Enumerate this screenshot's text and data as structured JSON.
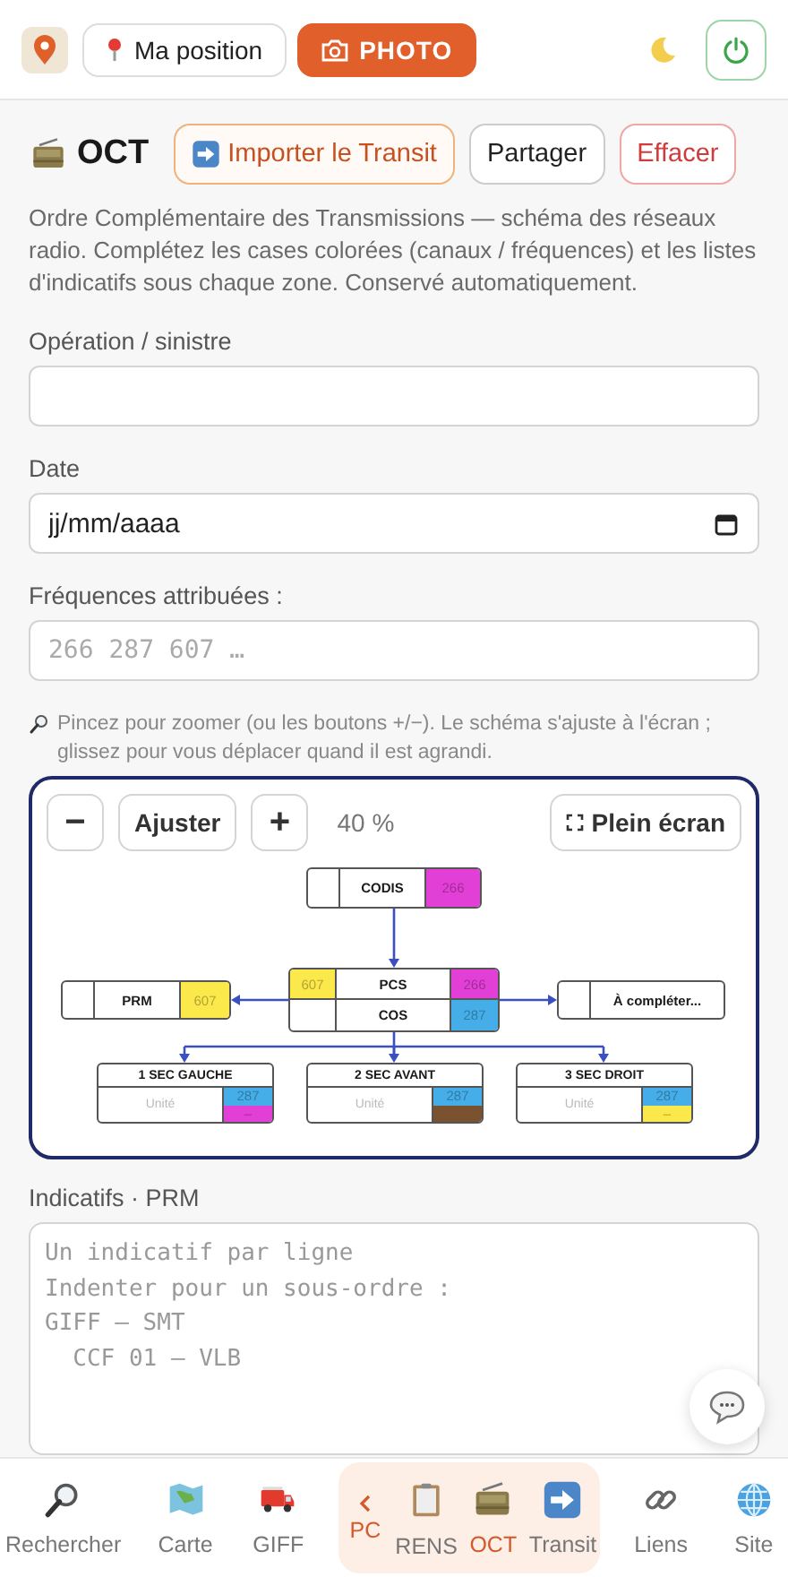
{
  "header": {
    "position_button": "Ma position",
    "photo_button": "PHOTO"
  },
  "title": {
    "text": "OCT",
    "actions": [
      {
        "kind": "primary",
        "label": "Importer le Transit"
      },
      {
        "kind": "neutral",
        "label": "Partager"
      },
      {
        "kind": "danger",
        "label": "Effacer"
      }
    ]
  },
  "description": "Ordre Complémentaire des Transmissions — schéma des réseaux radio. Complétez les cases colorées (canaux / fréquences) et les listes d'indicatifs sous chaque zone. Conservé automatiquement.",
  "fields": [
    {
      "label": "Opération / sinistre",
      "kind": "text"
    },
    {
      "label": "Date",
      "kind": "date",
      "placeholder": "jj/mm/aaaa"
    },
    {
      "label": "Fréquences attribuées :",
      "kind": "mono",
      "placeholder": "266 287 607 …"
    }
  ],
  "hint": "Pincez pour zoomer (ou les boutons +/−). Le schéma s'ajuste à l'écran ; glissez pour vous déplacer quand il est agrandi.",
  "diagram": {
    "zoom_out": "−",
    "fit": "Ajuster",
    "zoom_in": "+",
    "zoom_level": "40 %",
    "fullscreen": "Plein écran",
    "top": {
      "label": "CODIS",
      "channel": {
        "text": "266",
        "color": "#e23fd6"
      }
    },
    "center": {
      "top_label": "PCS",
      "bottom_label": "COS",
      "left_channel": {
        "text": "607",
        "color": "#fbe84a"
      },
      "right_channels": [
        {
          "text": "266",
          "color": "#e23fd6"
        },
        {
          "text": "287",
          "color": "#45aee8"
        }
      ]
    },
    "left": {
      "label": "PRM",
      "channel": {
        "text": "607",
        "color": "#fbe84a"
      }
    },
    "right": {
      "label": "À compléter..."
    },
    "sectors": [
      {
        "label": "1 SEC GAUCHE",
        "placeholder": "Unité",
        "channels": [
          {
            "text": "287",
            "color": "#45aee8"
          },
          {
            "text": "–",
            "color": "#e23fd6"
          }
        ]
      },
      {
        "label": "2 SEC AVANT",
        "placeholder": "Unité",
        "channels": [
          {
            "text": "287",
            "color": "#45aee8"
          },
          {
            "color": "#7a5230"
          }
        ]
      },
      {
        "label": "3 SEC DROIT",
        "placeholder": "Unité",
        "channels": [
          {
            "text": "287",
            "color": "#45aee8"
          },
          {
            "text": "–",
            "color": "#fbe84a"
          }
        ]
      }
    ]
  },
  "indicatifs": {
    "label": "Indicatifs · PRM",
    "placeholder": "Un indicatif par ligne\nIndenter pour un sous-ordre :\nGIFF – SMT\n  CCF 01 – VLB"
  },
  "nav": {
    "items": [
      {
        "kind": "item",
        "label": "Rechercher",
        "selected": false
      },
      {
        "kind": "item",
        "label": "Carte",
        "selected": false
      },
      {
        "kind": "item",
        "label": "GIFF",
        "selected": false
      },
      {
        "kind": "group",
        "label": "PC",
        "expanded": true,
        "children": [
          {
            "label": "RENS",
            "selected": false
          },
          {
            "label": "OCT",
            "selected": true
          },
          {
            "label": "Transit",
            "selected": false
          }
        ]
      },
      {
        "kind": "item",
        "label": "Liens",
        "selected": false
      },
      {
        "kind": "item",
        "label": "Site",
        "selected": false
      }
    ]
  }
}
